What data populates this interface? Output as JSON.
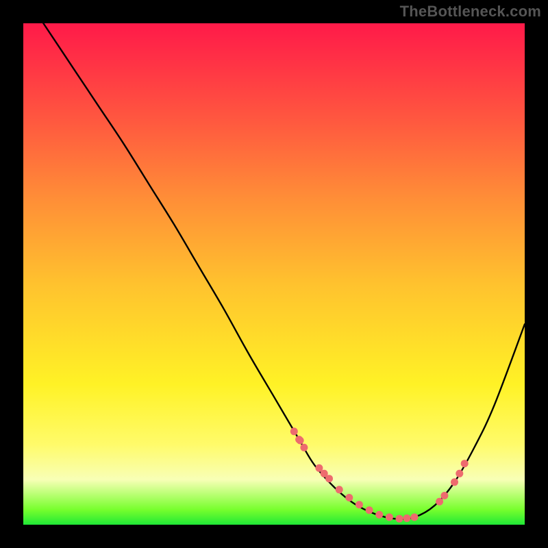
{
  "watermark": "TheBottleneck.com",
  "chart_data": {
    "type": "line",
    "title": "",
    "xlabel": "",
    "ylabel": "",
    "xlim": [
      0,
      100
    ],
    "ylim": [
      0,
      100
    ],
    "series": [
      {
        "name": "bottleneck-curve",
        "x": [
          4,
          10,
          15,
          20,
          25,
          30,
          35,
          40,
          45,
          50,
          55,
          58,
          62,
          66,
          70,
          74,
          78,
          82,
          86,
          90,
          94,
          100
        ],
        "y": [
          100,
          91,
          83.5,
          76,
          68,
          60,
          51.5,
          43,
          34,
          25.5,
          17,
          12,
          7.5,
          4.2,
          2.2,
          1.2,
          1.5,
          3.8,
          8.5,
          15.5,
          24,
          40
        ]
      }
    ],
    "scatter_points": {
      "name": "highlight-dots",
      "x": [
        54,
        55,
        55.2,
        56,
        59,
        60,
        61,
        63,
        65,
        67,
        69,
        71,
        73,
        75,
        76.5,
        78,
        83,
        84,
        86,
        87,
        88
      ],
      "y": [
        18.6,
        17,
        16.8,
        15.4,
        11.3,
        10.2,
        9.2,
        7,
        5.4,
        4,
        2.9,
        2,
        1.5,
        1.2,
        1.3,
        1.5,
        4.6,
        5.8,
        8.5,
        10.2,
        12.2
      ]
    },
    "dot_color": "#ed6b6e",
    "curve_color": "#000000",
    "gradient_stops": [
      {
        "pos": 0.0,
        "color": "#ff1a49"
      },
      {
        "pos": 0.35,
        "color": "#ff8e37"
      },
      {
        "pos": 0.72,
        "color": "#fff226"
      },
      {
        "pos": 0.91,
        "color": "#f8ffb6"
      },
      {
        "pos": 1.0,
        "color": "#20e836"
      }
    ]
  }
}
